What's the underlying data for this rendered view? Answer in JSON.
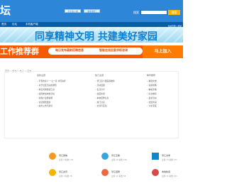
{
  "header": {
    "logo": "坛",
    "buttons": [
      "手机客户端",
      "联系我们"
    ],
    "search_label": "搜索",
    "search_placeholder": "",
    "search_button": "搜索"
  },
  "nav": [
    "首页",
    "论坛",
    "手机客户端"
  ],
  "top_link": "当前页面 | 帮助",
  "hero_title": "同享精神文明 共建美好家园",
  "banner": {
    "left": "工作推荐群",
    "mid_left": "每日发布最新招聘信息",
    "mid_right": "智能在线回复求职咨询",
    "right": "马上加入"
  },
  "breadcrumb": "首页 > 版块 > 帖子 > 正文",
  "columns": {
    "left": "最新主题",
    "middle": "热门主题",
    "right": "精华推荐"
  },
  "lists": {
    "left": [
      "平安的家人 一心一意 共同进步",
      "关于社区活动的通知",
      "常见问题答疑汇总",
      "如何参加本地活动",
      "新用户注册说明",
      "论坛规则更新",
      "站务公告与建议"
    ],
    "middle": [
      "望江县人民医院推荐",
      "活动回顾",
      "生活分享",
      "社区新闻",
      "本地招聘信息",
      "热门讨论",
      "交流与互动"
    ],
    "right": [
      "精选文章",
      "实用攻略",
      "精彩影像",
      "好文推荐",
      "最新活动",
      "社区风采",
      "讨论专区"
    ]
  },
  "cards": [
    {
      "title": "望江微信",
      "stats": "主题 4 帖数 139"
    },
    {
      "title": "望江互助",
      "stats": "主题 16 帖数 156"
    },
    {
      "title": "望江文学",
      "stats": "主题 70 帖数 271"
    },
    {
      "title": "望江资讯",
      "stats": "主题 3 帖数 78"
    },
    {
      "title": "望江招聘",
      "stats": "主题 11 帖数 58"
    },
    {
      "title": "本地新闻",
      "stats": "主题 31 帖数 151"
    }
  ],
  "colors": {
    "header": "#2d86d8",
    "nav": "#0b5ca8",
    "banner": "#f55a03",
    "hero": "#b8e5f7"
  }
}
